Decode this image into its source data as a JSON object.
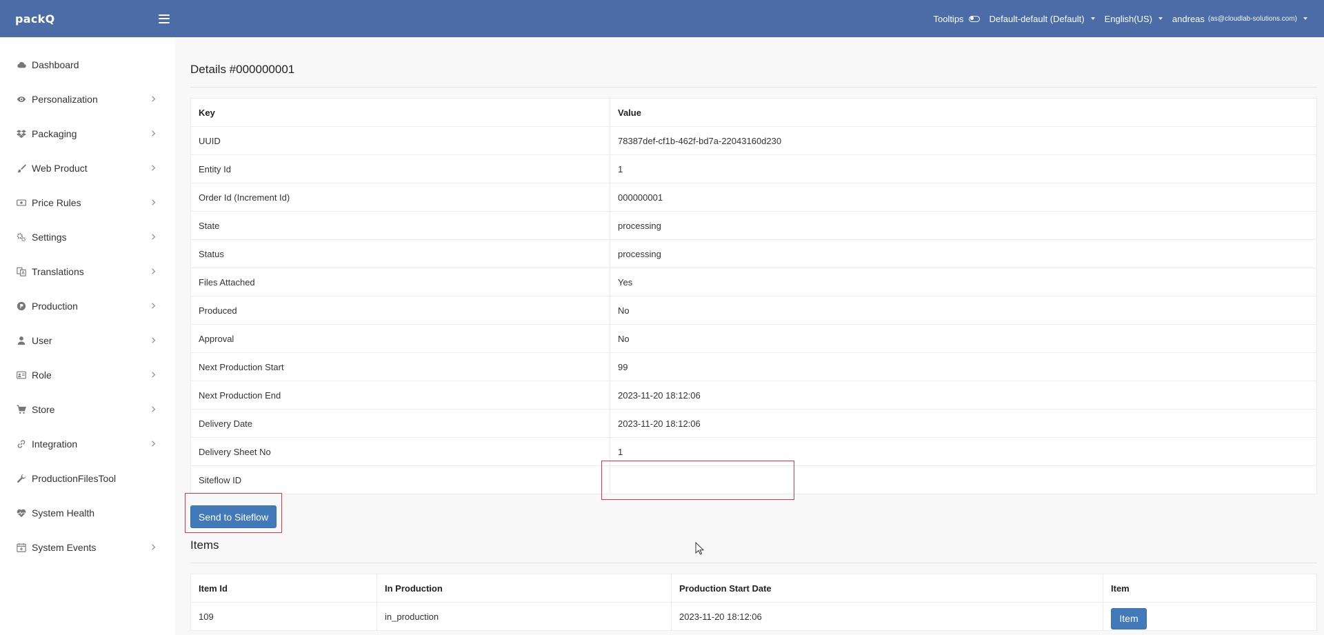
{
  "app": {
    "logo": "packQ"
  },
  "header": {
    "tooltips_label": "Tooltips",
    "store_selector": "Default-default (Default)",
    "language_selector": "English(US)",
    "user_name": "andreas",
    "user_email": "(as@cloudlab-solutions.com)"
  },
  "sidebar": {
    "items": [
      {
        "label": "Dashboard"
      },
      {
        "label": "Personalization"
      },
      {
        "label": "Packaging"
      },
      {
        "label": "Web Product"
      },
      {
        "label": "Price Rules"
      },
      {
        "label": "Settings"
      },
      {
        "label": "Translations"
      },
      {
        "label": "Production"
      },
      {
        "label": "User"
      },
      {
        "label": "Role"
      },
      {
        "label": "Store"
      },
      {
        "label": "Integration"
      },
      {
        "label": "ProductionFilesTool"
      },
      {
        "label": "System Health"
      },
      {
        "label": "System Events"
      }
    ]
  },
  "details": {
    "title": "Details #000000001",
    "columns": {
      "key": "Key",
      "value": "Value"
    },
    "rows": [
      {
        "key": "UUID",
        "value": "78387def-cf1b-462f-bd7a-22043160d230"
      },
      {
        "key": "Entity Id",
        "value": "1"
      },
      {
        "key": "Order Id (Increment Id)",
        "value": "000000001"
      },
      {
        "key": "State",
        "value": "processing"
      },
      {
        "key": "Status",
        "value": "processing"
      },
      {
        "key": "Files Attached",
        "value": "Yes"
      },
      {
        "key": "Produced",
        "value": "No"
      },
      {
        "key": "Approval",
        "value": "No"
      },
      {
        "key": "Next Production Start",
        "value": "99"
      },
      {
        "key": "Next Production End",
        "value": "2023-11-20 18:12:06"
      },
      {
        "key": "Delivery Date",
        "value": "2023-11-20 18:12:06"
      },
      {
        "key": "Delivery Sheet No",
        "value": "1"
      },
      {
        "key": "Siteflow ID",
        "value": ""
      }
    ],
    "send_button": "Send to Siteflow"
  },
  "items": {
    "title": "Items",
    "columns": [
      "Item Id",
      "In Production",
      "Production Start Date",
      "Item"
    ],
    "rows": [
      {
        "item_id": "109",
        "in_production": "in_production",
        "start_date": "2023-11-20 18:12:06",
        "button": "Item"
      }
    ]
  }
}
